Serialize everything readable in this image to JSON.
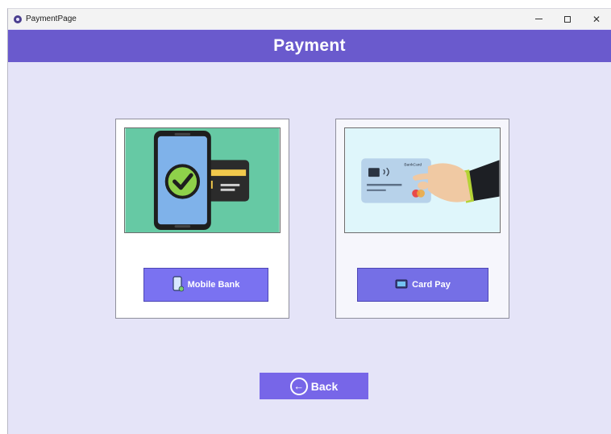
{
  "window": {
    "title": "PaymentPage",
    "icon": "app-icon",
    "controls": {
      "minimize": "minimize-icon",
      "maximize": "maximize-icon",
      "close": "✕"
    }
  },
  "header": {
    "title": "Payment"
  },
  "options": [
    {
      "id": "mobile-bank",
      "label": "Mobile Bank",
      "image": "phone-with-check-and-card-illustration",
      "icon": "mobile-phone-icon"
    },
    {
      "id": "card-pay",
      "label": "Card Pay",
      "image": "hand-holding-bank-card-illustration",
      "card_text": "BankCard",
      "icon": "card-icon"
    }
  ],
  "back_button": {
    "label": "Back",
    "icon": "back-arrow-icon"
  },
  "colors": {
    "header": "#6a5acd",
    "background": "#e5e4f8",
    "button": "#7a72f1",
    "mobile_image_bg": "#66c9a4",
    "card_image_bg": "#dff6fb"
  }
}
